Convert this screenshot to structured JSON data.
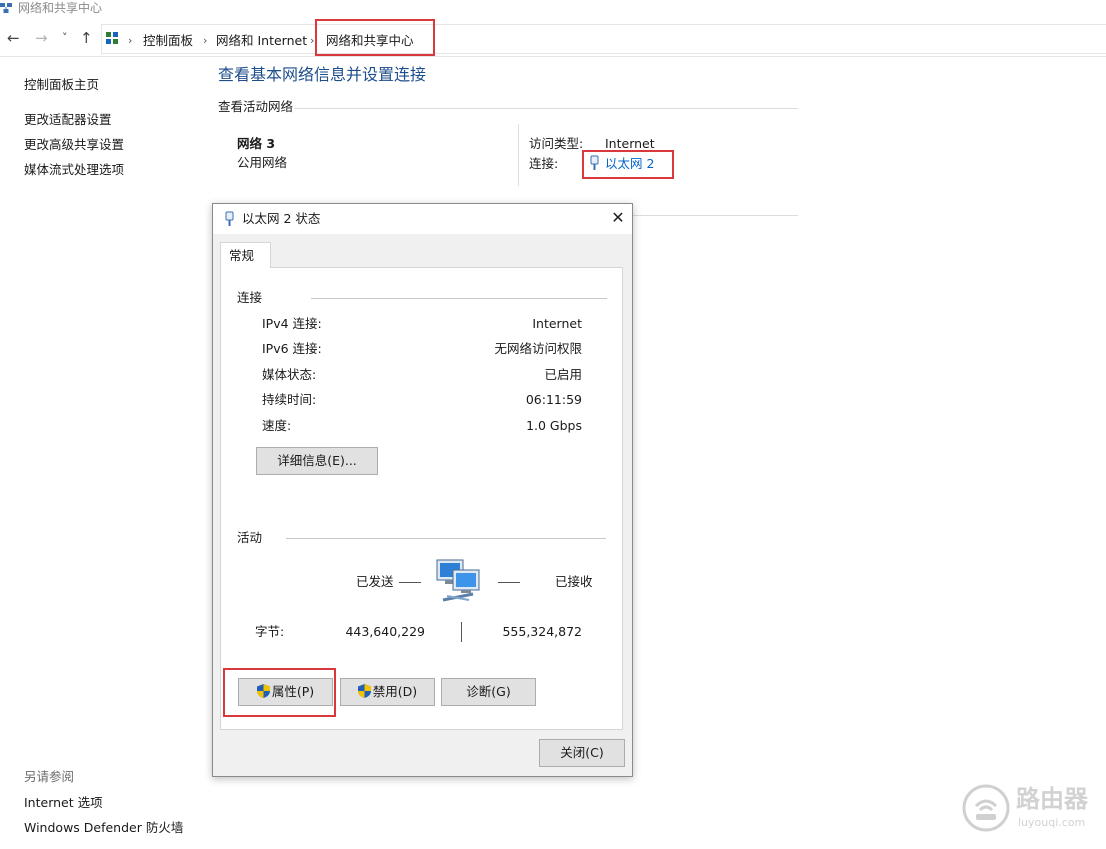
{
  "window": {
    "title": "网络和共享中心"
  },
  "nav": {
    "back": "←",
    "forward": "→",
    "recent": "˅",
    "up": "↑",
    "breadcrumbs": [
      "控制面板",
      "网络和 Internet",
      "网络和共享中心"
    ],
    "separator": "›"
  },
  "sidebar": {
    "home": "控制面板主页",
    "links": [
      "更改适配器设置",
      "更改高级共享设置",
      "媒体流式处理选项"
    ],
    "see_also_title": "另请参阅",
    "see_also": [
      "Internet 选项",
      "Windows Defender 防火墙"
    ]
  },
  "main": {
    "heading": "查看基本网络信息并设置连接",
    "active_networks_label": "查看活动网络",
    "network_name": "网络 3",
    "network_type": "公用网络",
    "access_type_label": "访问类型:",
    "access_type_value": "Internet",
    "connection_label": "连接:",
    "connection_value": "以太网 2"
  },
  "dialog": {
    "title": "以太网 2 状态",
    "close": "✕",
    "tab": "常规",
    "connection_group": "连接",
    "rows": [
      {
        "label": "IPv4 连接:",
        "value": "Internet"
      },
      {
        "label": "IPv6 连接:",
        "value": "无网络访问权限"
      },
      {
        "label": "媒体状态:",
        "value": "已启用"
      },
      {
        "label": "持续时间:",
        "value": "06:11:59"
      },
      {
        "label": "速度:",
        "value": "1.0 Gbps"
      }
    ],
    "details_button": "详细信息(E)...",
    "activity_group": "活动",
    "sent_label": "已发送",
    "received_label": "已接收",
    "bytes_label": "字节:",
    "bytes_sent": "443,640,229",
    "bytes_received": "555,324,872",
    "properties_button": "属性(P)",
    "disable_button": "禁用(D)",
    "diagnose_button": "诊断(G)",
    "close_button": "关闭(C)"
  },
  "watermark": {
    "text": "路由器",
    "url_text": "luyouqi.com"
  },
  "colors": {
    "highlight": "#d9383c",
    "link": "#0066cc",
    "heading": "#1e4e8c"
  }
}
